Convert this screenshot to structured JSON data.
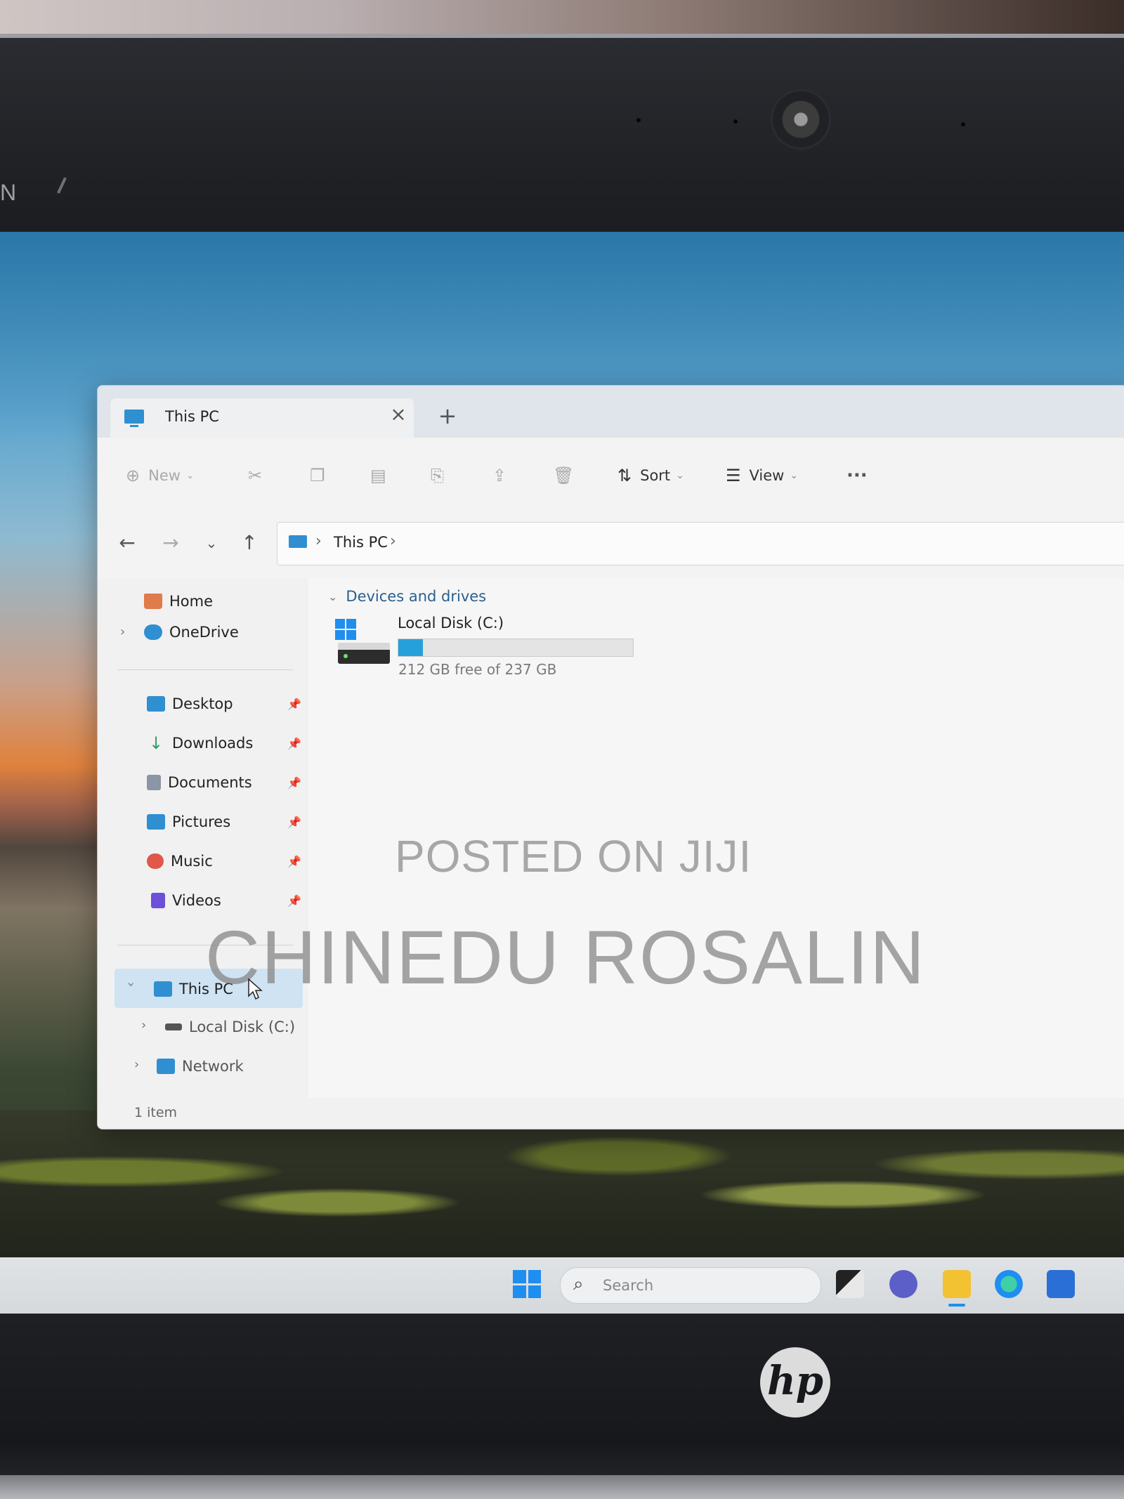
{
  "bezel": {
    "brand_fragment": "N"
  },
  "window": {
    "tab_title": "This PC",
    "tab_close": "×",
    "tab_add": "+"
  },
  "toolbar": {
    "new_label": "New",
    "sort_label": "Sort",
    "view_label": "View",
    "more_label": "···"
  },
  "address": {
    "crumb": "This PC"
  },
  "sidebar": {
    "home": "Home",
    "onedrive": "OneDrive",
    "quick": [
      {
        "label": "Desktop",
        "icon": "desktop-icon",
        "color": "#2f8fd1"
      },
      {
        "label": "Downloads",
        "icon": "download-icon",
        "color": "#2f9e5c"
      },
      {
        "label": "Documents",
        "icon": "document-icon",
        "color": "#8a96a6"
      },
      {
        "label": "Pictures",
        "icon": "pictures-icon",
        "color": "#2f8fd1"
      },
      {
        "label": "Music",
        "icon": "music-icon",
        "color": "#e0584a"
      },
      {
        "label": "Videos",
        "icon": "videos-icon",
        "color": "#6e4fd8"
      }
    ],
    "this_pc": "This PC",
    "local_disk": "Local Disk (C:)",
    "network": "Network"
  },
  "content": {
    "group_title": "Devices and drives",
    "drive_name": "Local Disk (C:)",
    "drive_free": "212 GB free of 237 GB",
    "drive_used_fraction": 0.105
  },
  "status": {
    "items": "1 item"
  },
  "watermark": {
    "line1": "POSTED ON JIJI",
    "line2": "CHINEDU ROSALIN"
  },
  "taskbar": {
    "search_placeholder": "Search"
  },
  "laptop": {
    "logo": "hp"
  }
}
